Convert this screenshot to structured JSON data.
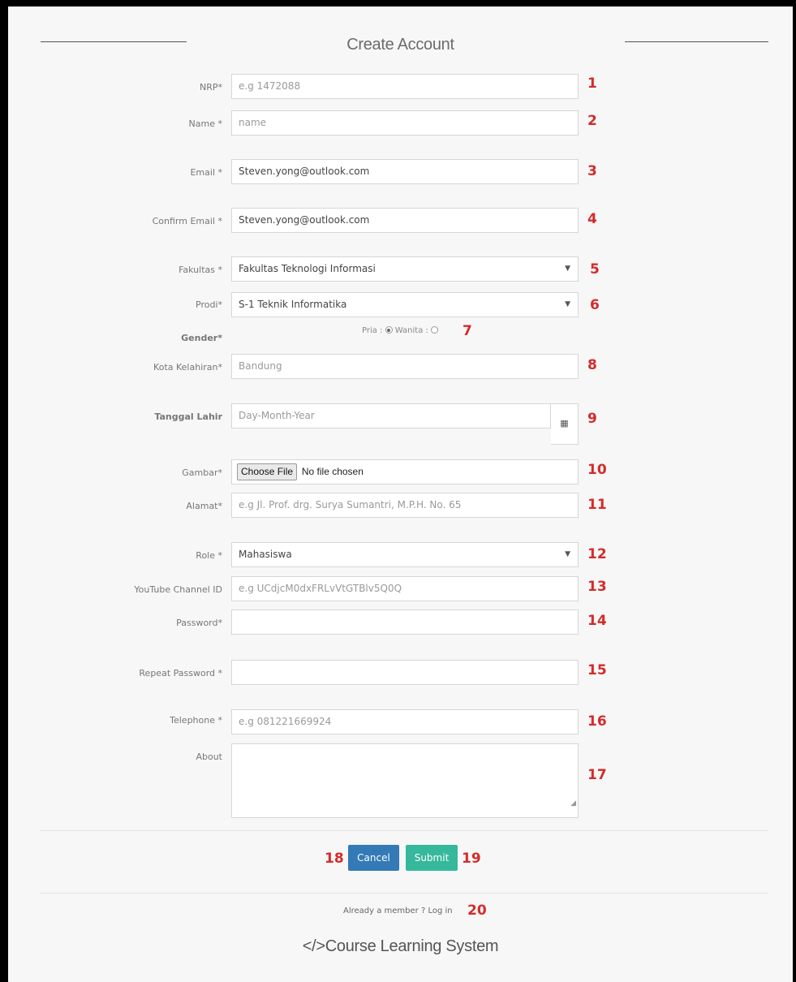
{
  "page": {
    "title": "Create Account"
  },
  "form": {
    "nrp": {
      "label": "NRP*",
      "placeholder": "e.g 1472088",
      "marker": "1"
    },
    "name": {
      "label": "Name *",
      "placeholder": "name",
      "marker": "2"
    },
    "email": {
      "label": "Email *",
      "value": "Steven.yong@outlook.com",
      "marker": "3"
    },
    "confirm_email": {
      "label": "Confirm Email *",
      "value": "Steven.yong@outlook.com",
      "marker": "4"
    },
    "fakultas": {
      "label": "Fakultas *",
      "selected": "Fakultas Teknologi Informasi",
      "marker": "5"
    },
    "prodi": {
      "label": "Prodi*",
      "selected": "S-1 Teknik Informatika",
      "marker": "6"
    },
    "gender": {
      "label": "Gender*",
      "option_pria": "Pria :",
      "option_wanita": "Wanita :",
      "selected": "Pria",
      "marker": "7"
    },
    "kota_kelahiran": {
      "label": "Kota Kelahiran*",
      "placeholder": "Bandung",
      "marker": "8"
    },
    "tanggal_lahir": {
      "label": "Tanggal Lahir",
      "placeholder": "Day-Month-Year",
      "marker": "9"
    },
    "gambar": {
      "label": "Gambar*",
      "button": "Choose File",
      "status": "No file chosen",
      "marker": "10"
    },
    "alamat": {
      "label": "Alamat*",
      "placeholder": "e.g Jl. Prof. drg. Surya Sumantri, M.P.H. No. 65",
      "marker": "11"
    },
    "role": {
      "label": "Role *",
      "selected": "Mahasiswa",
      "marker": "12"
    },
    "youtube": {
      "label": "YouTube Channel ID",
      "placeholder": "e.g UCdjcM0dxFRLvVtGTBlv5Q0Q",
      "marker": "13"
    },
    "password": {
      "label": "Password*",
      "value": "",
      "marker": "14"
    },
    "repeat_password": {
      "label": "Repeat Password *",
      "value": "",
      "marker": "15"
    },
    "telephone": {
      "label": "Telephone *",
      "placeholder": "e.g 081221669924",
      "marker": "16"
    },
    "about": {
      "label": "About",
      "value": "",
      "marker": "17"
    }
  },
  "actions": {
    "cancel": {
      "label": "Cancel",
      "marker": "18",
      "color": "#337ab7"
    },
    "submit": {
      "label": "Submit",
      "marker": "19",
      "color": "#36b89c"
    }
  },
  "footer": {
    "member_text": "Already a member ? Log in",
    "marker": "20",
    "brand": "</>Course Learning System"
  },
  "colors": {
    "marker": "#d42b2b",
    "background": "#f7f7f7"
  },
  "icons": {
    "calendar": "calendar-icon",
    "select_arrow": "chevron-down-icon"
  }
}
